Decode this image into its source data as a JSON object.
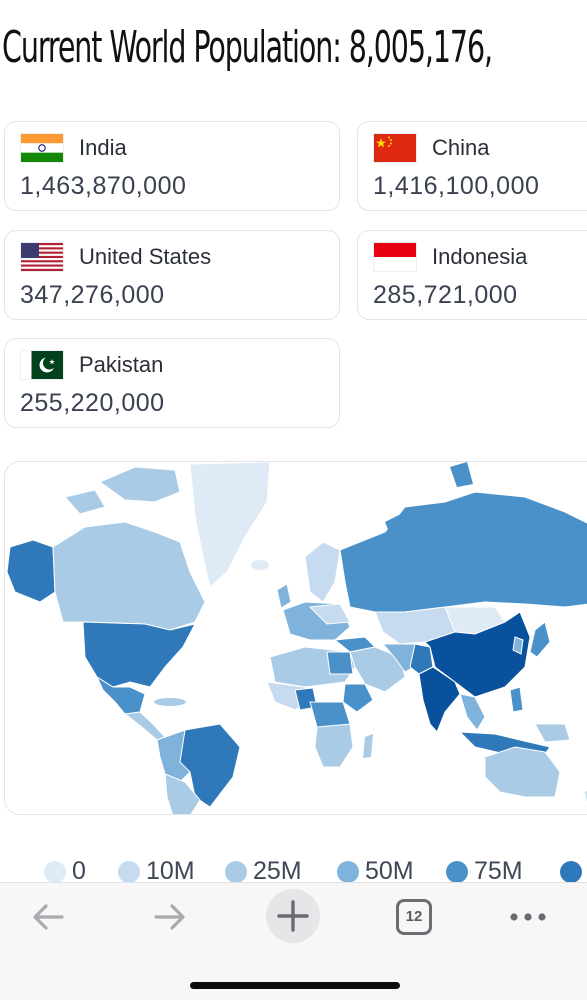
{
  "headline": "Current World Population: 8,005,176,",
  "countries": [
    {
      "name": "India",
      "population": "1,463,870,000",
      "flag": "india-flag"
    },
    {
      "name": "China",
      "population": "1,416,100,000",
      "flag": "china-flag"
    },
    {
      "name": "United States",
      "population": "347,276,000",
      "flag": "usa-flag"
    },
    {
      "name": "Indonesia",
      "population": "285,721,000",
      "flag": "indonesia-flag"
    },
    {
      "name": "Pakistan",
      "population": "255,220,000",
      "flag": "pakistan-flag"
    }
  ],
  "legend": [
    {
      "label": "0",
      "color": "#deebf7"
    },
    {
      "label": "10M",
      "color": "#c6dbef"
    },
    {
      "label": "25M",
      "color": "#a9cbe6"
    },
    {
      "label": "50M",
      "color": "#7fb3db"
    },
    {
      "label": "75M",
      "color": "#4a91c9"
    },
    {
      "label": "",
      "color": "#2f79ba"
    }
  ],
  "map_colors": {
    "lowest": "#deebf7",
    "low": "#c6dbef",
    "mid": "#a9cbe6",
    "high": "#7fb3db",
    "higher": "#4a91c9",
    "very_high": "#2f79ba",
    "top": "#08519c"
  },
  "toolbar": {
    "back_icon": "back-arrow-icon",
    "forward_icon": "forward-arrow-icon",
    "new_tab_icon": "plus-icon",
    "tab_count": "12",
    "more_icon": "more-dots-icon"
  }
}
